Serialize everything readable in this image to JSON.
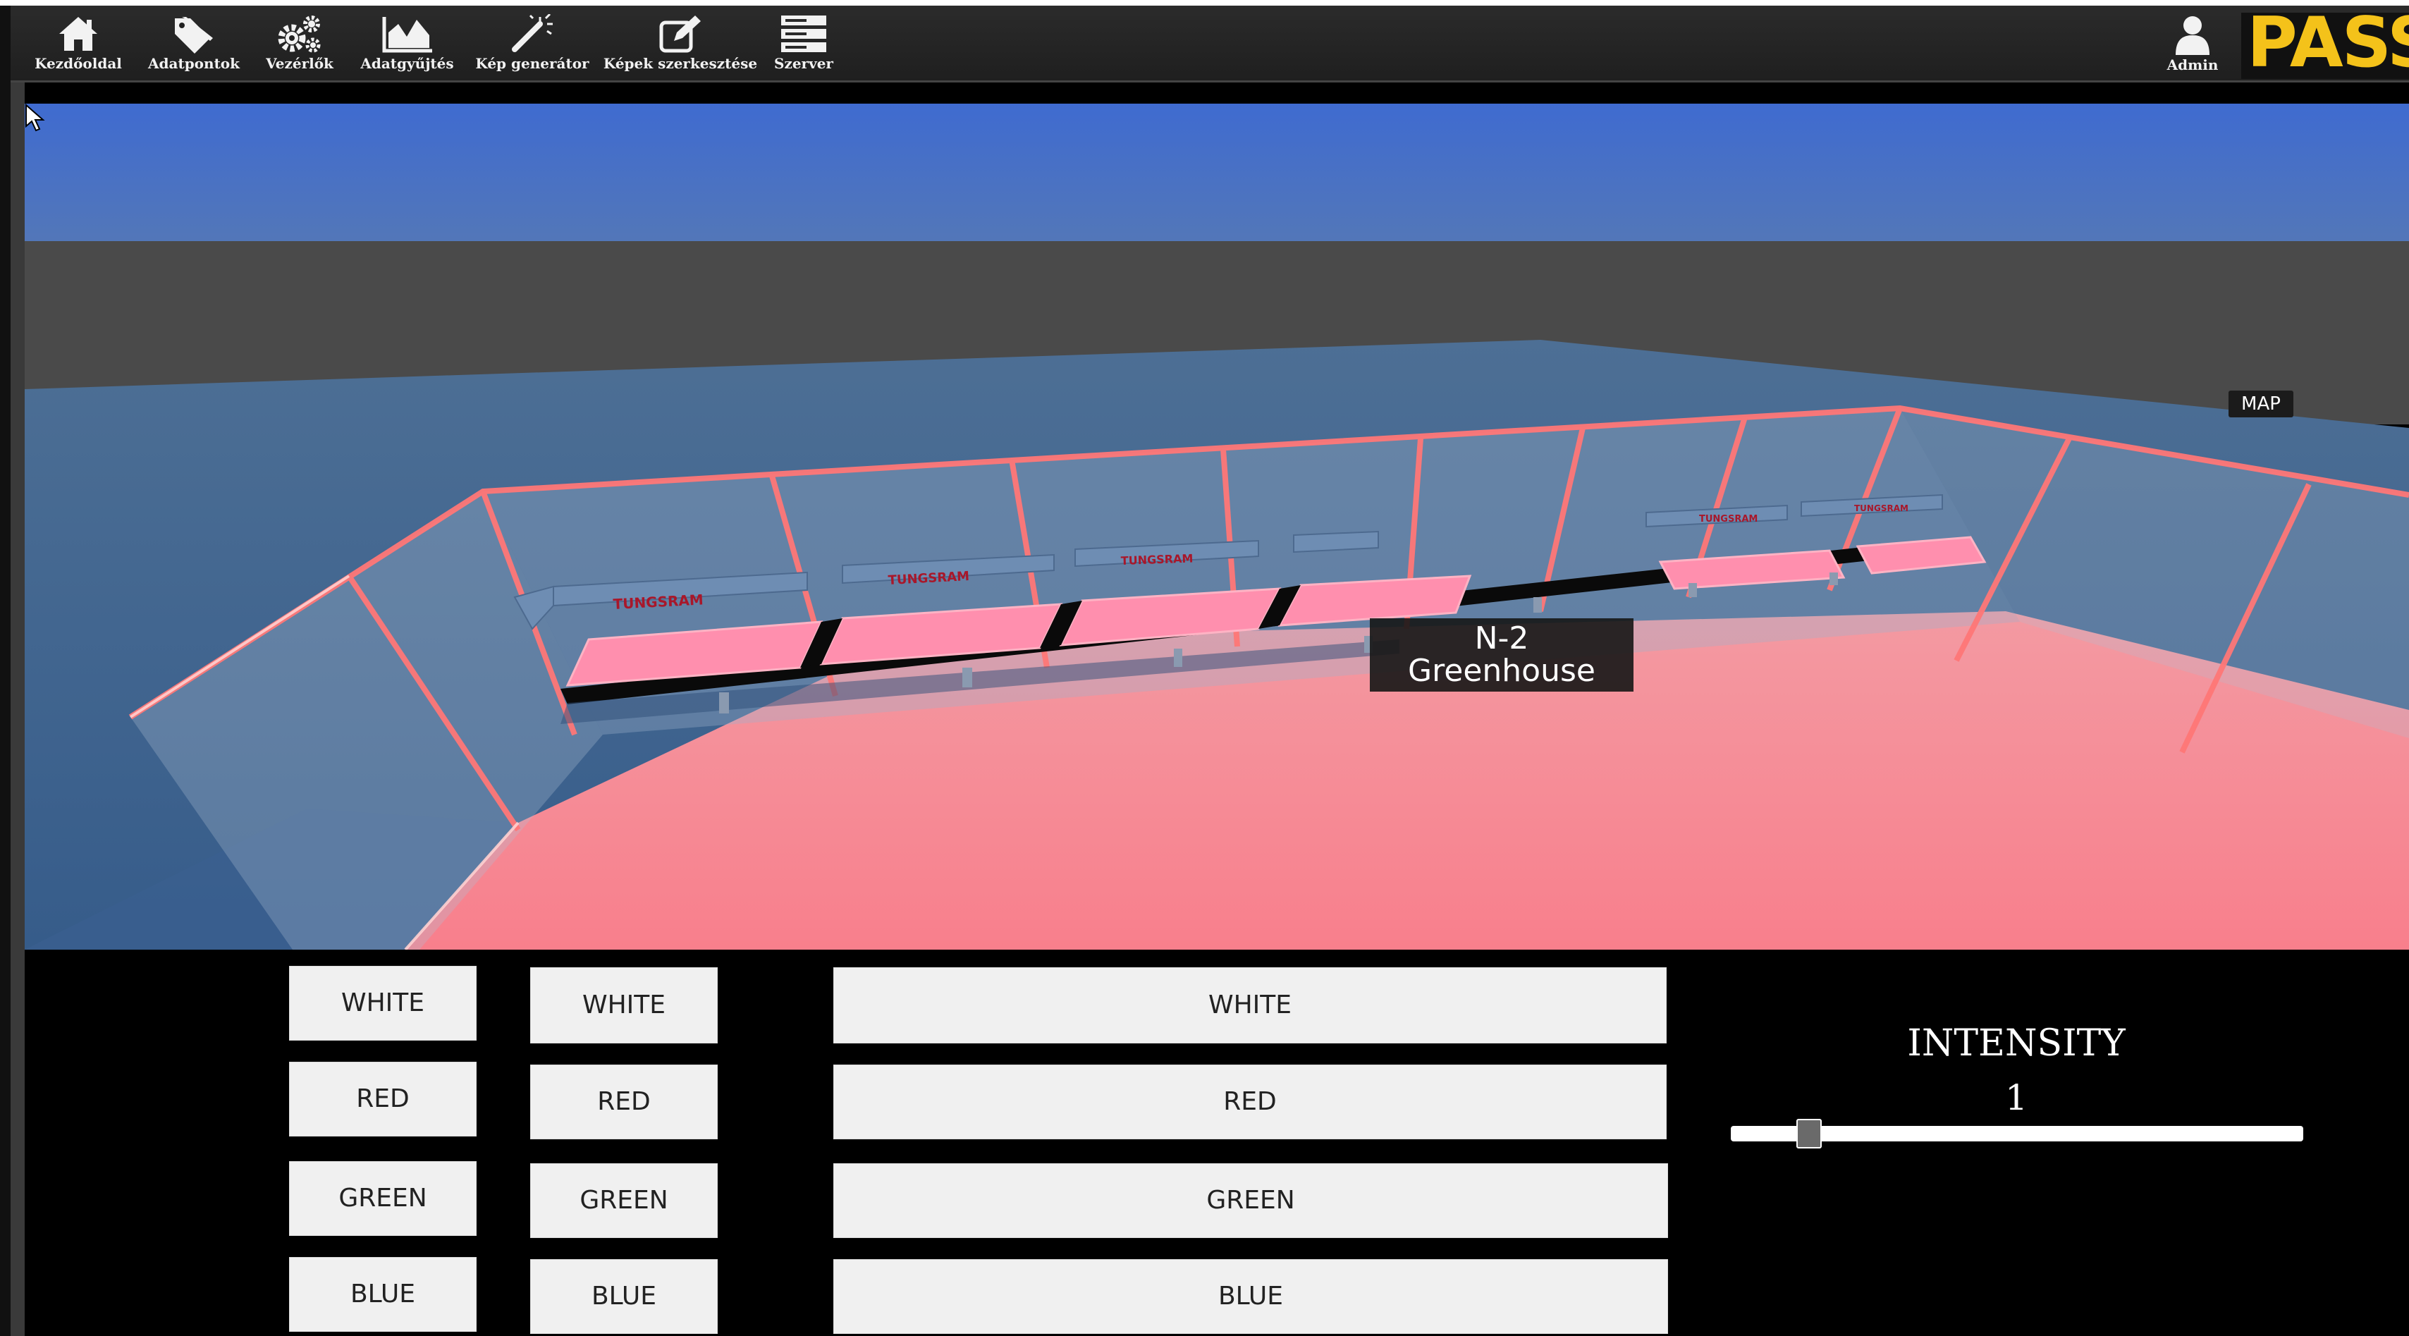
{
  "toolbar": {
    "items": [
      {
        "label": "Kezdőoldal",
        "icon": "home-icon"
      },
      {
        "label": "Adatpontok",
        "icon": "tag-icon"
      },
      {
        "label": "Vezérlők",
        "icon": "gears-icon"
      },
      {
        "label": "Adatgyűjtés",
        "icon": "area-chart-icon"
      },
      {
        "label": "Kép generátor",
        "icon": "magic-wand-icon"
      },
      {
        "label": "Képek szerkesztése",
        "icon": "edit-icon"
      },
      {
        "label": "Szerver",
        "icon": "server-icon"
      }
    ],
    "user": {
      "label": "Admin",
      "icon": "user-icon"
    },
    "logo_text": "PASS",
    "accent": "#f4c21a"
  },
  "viewport": {
    "map_label": "MAP",
    "greenhouse_label": {
      "line1": "N-2",
      "line2": "Greenhouse"
    },
    "lamp_brand": "TUNGSRAM",
    "colors": {
      "sky": "#3f6cc8",
      "floor": "#f58a96",
      "frame": "#ff6f6f"
    }
  },
  "controls": {
    "column1": [
      "WHITE",
      "RED",
      "GREEN",
      "BLUE"
    ],
    "column2": [
      "WHITE",
      "RED",
      "GREEN",
      "BLUE"
    ],
    "column3": [
      "WHITE",
      "RED",
      "GREEN",
      "BLUE"
    ],
    "intensity": {
      "title": "INTENSITY",
      "value": "1",
      "fraction": 0.12
    }
  }
}
